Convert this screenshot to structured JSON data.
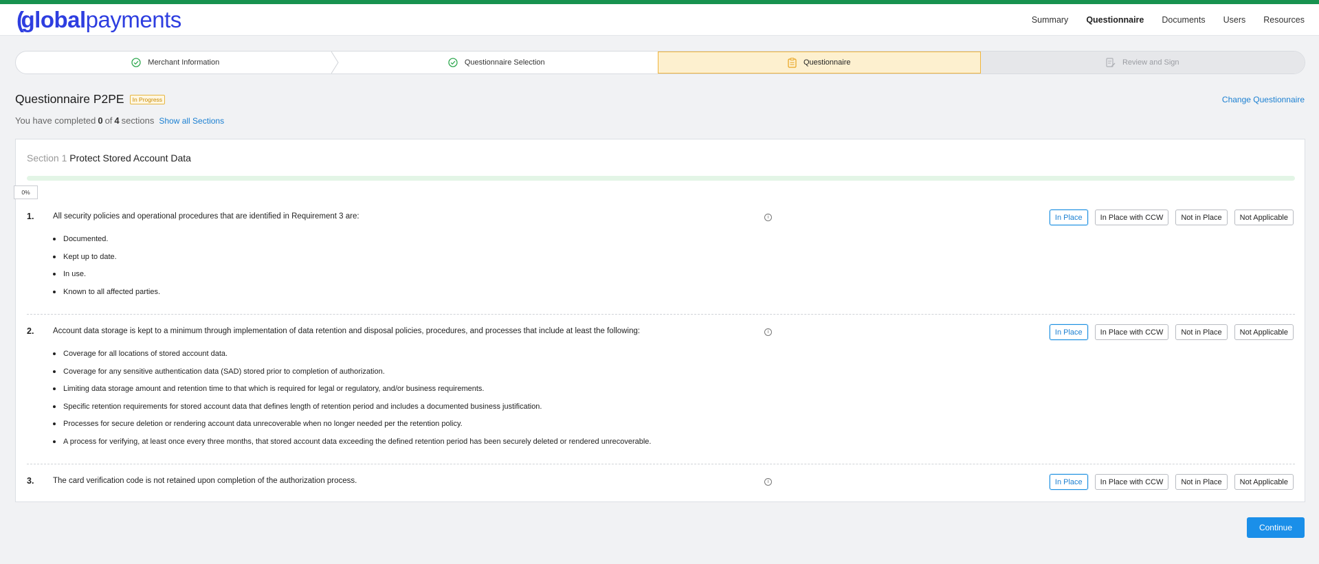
{
  "brand": {
    "logo_paren": "(",
    "logo_bold": "global",
    "logo_light": "payments"
  },
  "nav": {
    "items": [
      "Summary",
      "Questionnaire",
      "Documents",
      "Users",
      "Resources"
    ],
    "active": "Questionnaire"
  },
  "stepper": [
    {
      "label": "Merchant Information",
      "state": "done"
    },
    {
      "label": "Questionnaire Selection",
      "state": "done"
    },
    {
      "label": "Questionnaire",
      "state": "current"
    },
    {
      "label": "Review and Sign",
      "state": "disabled"
    }
  ],
  "page": {
    "title": "Questionnaire P2PE",
    "status_badge": "In Progress",
    "change_link": "Change Questionnaire",
    "progress_prefix": "You have completed",
    "completed": "0",
    "of": "of",
    "total": "4",
    "sections_word": "sections",
    "show_all": "Show all Sections"
  },
  "section": {
    "number_label": "Section 1",
    "name": "Protect Stored Account Data",
    "percent": "0%",
    "progress_fraction": 0
  },
  "options": [
    "In Place",
    "In Place with CCW",
    "Not in Place",
    "Not Applicable"
  ],
  "questions": [
    {
      "number": "1.",
      "text": "All security policies and operational procedures that are identified in Requirement 3 are:",
      "selected": "In Place",
      "bullets": [
        "Documented.",
        "Kept up to date.",
        "In use.",
        "Known to all affected parties."
      ]
    },
    {
      "number": "2.",
      "text": "Account data storage is kept to a minimum through implementation of data retention and disposal policies, procedures, and processes that include at least the following:",
      "selected": "In Place",
      "bullets": [
        "Coverage for all locations of stored account data.",
        "Coverage for any sensitive authentication data (SAD) stored prior to completion of authorization.",
        "Limiting data storage amount and retention time to that which is required for legal or regulatory, and/or business requirements.",
        "Specific retention requirements for stored account data that defines length of retention period and includes a documented business justification.",
        "Processes for secure deletion or rendering account data unrecoverable when no longer needed per the retention policy.",
        "A process for verifying, at least once every three months, that stored account data exceeding the defined retention period has been securely deleted or rendered unrecoverable."
      ]
    },
    {
      "number": "3.",
      "text": "The card verification code is not retained upon completion of the authorization process.",
      "selected": "In Place",
      "bullets": []
    }
  ],
  "footer": {
    "continue_label": "Continue"
  },
  "colors": {
    "brand_blue": "#2e3ee0",
    "top_stripe": "#17924f",
    "accent": "#1a8fe9",
    "step_current_bg": "#fdf0cf",
    "done_green": "#2fa84f"
  }
}
